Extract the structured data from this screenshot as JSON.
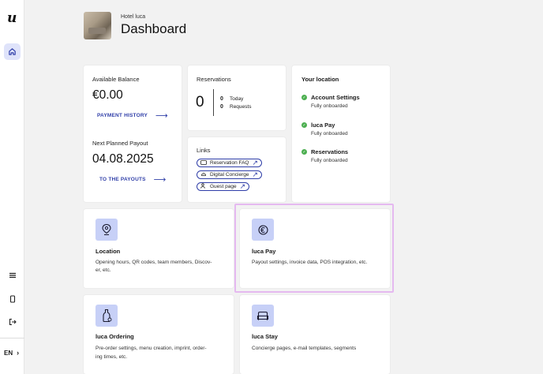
{
  "sidebar": {
    "logo": "u",
    "language": "EN"
  },
  "header": {
    "hotel_name": "Hotel luca",
    "title": "Dashboard"
  },
  "balance": {
    "available_label": "Available Balance",
    "available_value": "€0.00",
    "payment_history_link": "PAYMENT HISTORY",
    "next_payout_label": "Next Planned Payout",
    "next_payout_date": "04.08.2025",
    "payouts_link": "TO THE PAYOUTS"
  },
  "reservations": {
    "title": "Reservations",
    "total": "0",
    "today_count": "0",
    "today_label": "Today",
    "requests_count": "0",
    "requests_label": "Requests"
  },
  "links": {
    "title": "Links",
    "items": [
      "Reservation FAQ",
      "Digital Concierge",
      "Guest page"
    ]
  },
  "your_location": {
    "title": "Your location",
    "items": [
      {
        "title": "Account Settings",
        "status": "Fully onboarded"
      },
      {
        "title": "luca Pay",
        "status": "Fully onboarded"
      },
      {
        "title": "Reservations",
        "status": "Fully onboarded"
      }
    ]
  },
  "tiles": [
    {
      "title": "Location",
      "desc_line1": "Opening hours, QR codes, team members, Discov-",
      "desc_line2": "er, etc."
    },
    {
      "title": "luca Pay",
      "desc_line1": "Payout settings, invoice data, POS integration, etc.",
      "desc_line2": ""
    },
    {
      "title": "luca Ordering",
      "desc_line1": "Pre-order settings, menu creation, imprint, order-",
      "desc_line2": "ing times, etc."
    },
    {
      "title": "luca Stay",
      "desc_line1": "Concierge pages, e-mail templates, segments",
      "desc_line2": ""
    }
  ],
  "colors": {
    "accent": "#2f3ea8",
    "icon_bg": "#c7d0f7",
    "check": "#4caf50",
    "highlight": "#e5b9f0"
  }
}
